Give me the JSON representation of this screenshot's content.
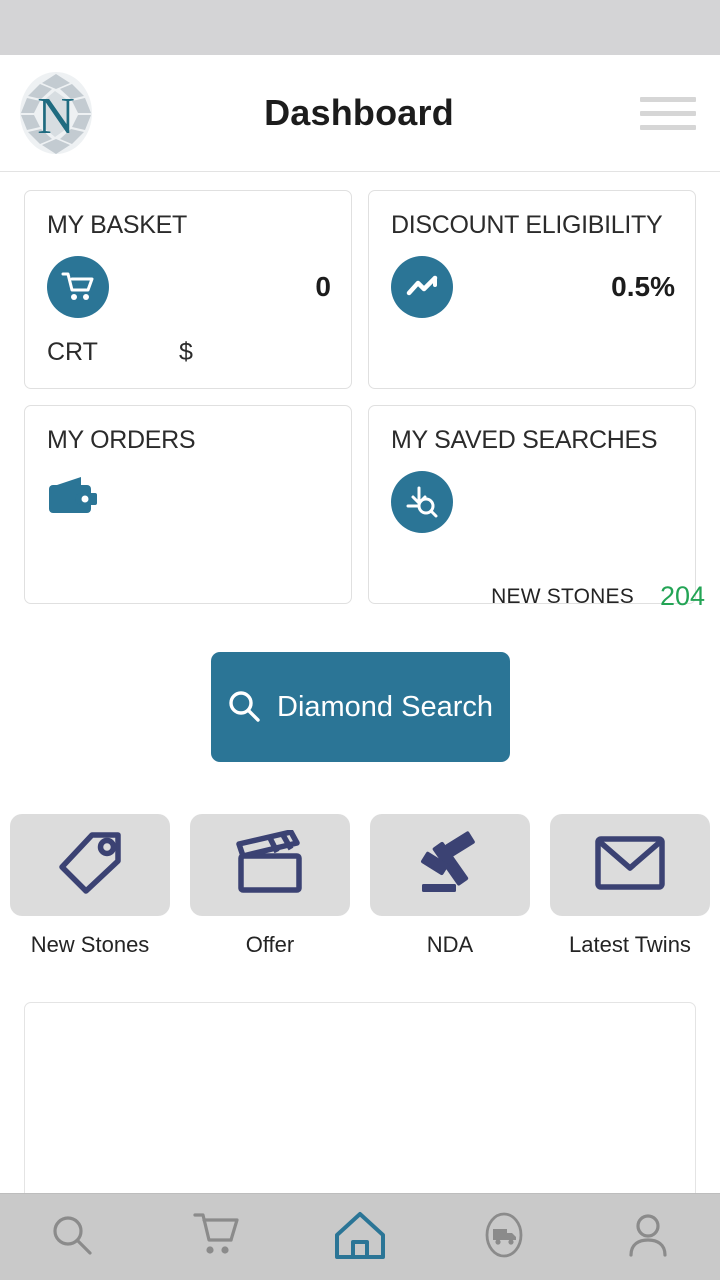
{
  "header": {
    "title": "Dashboard",
    "logo_letter": "N",
    "logo_icon": "diamond-logo-icon",
    "menu_icon": "hamburger-menu-icon"
  },
  "cards": [
    {
      "id": "my-basket",
      "title": "MY BASKET",
      "icon": "shopping-cart-icon",
      "value": "0",
      "unit_label": "CRT",
      "currency_label": "$"
    },
    {
      "id": "discount-eligibility",
      "title": "DISCOUNT ELIGIBILITY",
      "icon": "trending-up-icon",
      "value": "0.5%"
    },
    {
      "id": "my-orders",
      "title": "MY ORDERS",
      "icon": "wallet-icon"
    },
    {
      "id": "my-saved-searches",
      "title": "MY SAVED SEARCHES",
      "icon": "saved-search-icon",
      "foot_label": "NEW STONES",
      "foot_count": "204"
    }
  ],
  "search_button": {
    "label": "Diamond Search",
    "icon": "search-icon"
  },
  "tiles": [
    {
      "label": "New Stones",
      "icon": "tag-icon"
    },
    {
      "label": "Offer",
      "icon": "clapperboard-offer-icon"
    },
    {
      "label": "NDA",
      "icon": "gavel-icon"
    },
    {
      "label": "Latest Twins",
      "icon": "envelope-icon"
    }
  ],
  "bottom_nav": [
    {
      "id": "search",
      "icon": "search-icon",
      "active": false
    },
    {
      "id": "cart",
      "icon": "shopping-cart-icon",
      "active": false
    },
    {
      "id": "home",
      "icon": "home-icon",
      "active": true
    },
    {
      "id": "tracking",
      "icon": "delivery-truck-icon",
      "active": false
    },
    {
      "id": "profile",
      "icon": "person-icon",
      "active": false
    }
  ],
  "colors": {
    "teal": "#2b7596",
    "navy": "#3b4273",
    "green": "#23a455",
    "nav_inactive": "#8b8b8b",
    "status_bar": "#d4d4d6",
    "tile_bg": "#dcdcdc"
  }
}
